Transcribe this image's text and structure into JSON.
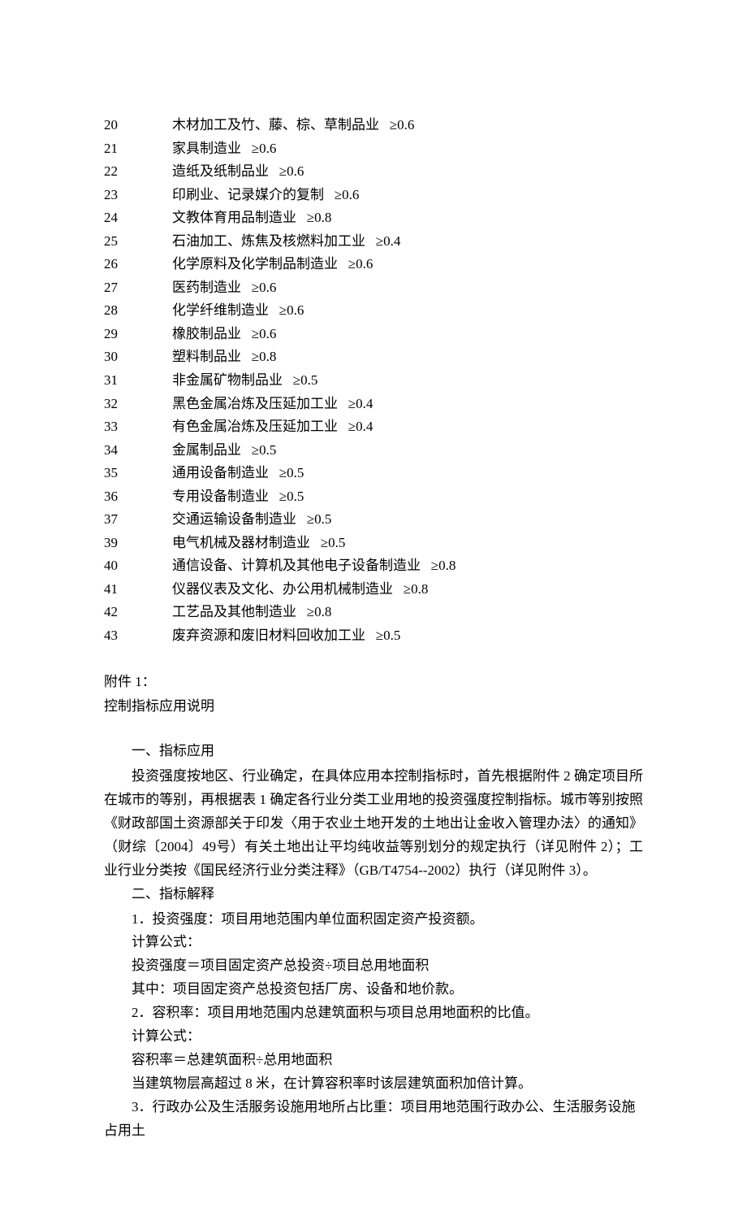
{
  "rows": [
    {
      "code": "20",
      "name": "木材加工及竹、藤、棕、草制品业",
      "value": "≥0.6"
    },
    {
      "code": "21",
      "name": "家具制造业",
      "value": "≥0.6"
    },
    {
      "code": "22",
      "name": "造纸及纸制品业",
      "value": "≥0.6"
    },
    {
      "code": "23",
      "name": "印刷业、记录媒介的复制",
      "value": "≥0.6"
    },
    {
      "code": "24",
      "name": "文教体育用品制造业",
      "value": "≥0.8"
    },
    {
      "code": "25",
      "name": "石油加工、炼焦及核燃料加工业",
      "value": "≥0.4"
    },
    {
      "code": "26",
      "name": "化学原料及化学制品制造业",
      "value": "≥0.6"
    },
    {
      "code": "27",
      "name": "医药制造业",
      "value": "≥0.6"
    },
    {
      "code": "28",
      "name": "化学纤维制造业",
      "value": "≥0.6"
    },
    {
      "code": "29",
      "name": "橡胶制品业",
      "value": "≥0.6"
    },
    {
      "code": "30",
      "name": "塑料制品业",
      "value": "≥0.8"
    },
    {
      "code": "31",
      "name": "非金属矿物制品业",
      "value": "≥0.5"
    },
    {
      "code": "32",
      "name": "黑色金属冶炼及压延加工业",
      "value": "≥0.4"
    },
    {
      "code": "33",
      "name": "有色金属冶炼及压延加工业",
      "value": "≥0.4"
    },
    {
      "code": "34",
      "name": "金属制品业",
      "value": "≥0.5"
    },
    {
      "code": "35",
      "name": "通用设备制造业",
      "value": "≥0.5"
    },
    {
      "code": "36",
      "name": "专用设备制造业",
      "value": "≥0.5"
    },
    {
      "code": "37",
      "name": "交通运输设备制造业",
      "value": "≥0.5"
    },
    {
      "code": "39",
      "name": "电气机械及器材制造业",
      "value": "≥0.5"
    },
    {
      "code": "40",
      "name": "通信设备、计算机及其他电子设备制造业",
      "value": "≥0.8"
    },
    {
      "code": "41",
      "name": "仪器仪表及文化、办公用机械制造业",
      "value": "≥0.8"
    },
    {
      "code": "42",
      "name": "工艺品及其他制造业",
      "value": "≥0.8"
    },
    {
      "code": "43",
      "name": "废弃资源和废旧材料回收加工业",
      "value": "≥0.5"
    }
  ],
  "attach": {
    "head": "附件 1：",
    "title": "控制指标应用说明"
  },
  "section1": {
    "title": "一、指标应用",
    "para": "投资强度按地区、行业确定，在具体应用本控制指标时，首先根据附件 2 确定项目所在城市的等别，再根据表 1 确定各行业分类工业用地的投资强度控制指标。城市等别按照《财政部国土资源部关于印发〈用于农业土地开发的土地出让金收入管理办法〉的通知》（财综〔2004〕49号）有关土地出让平均纯收益等别划分的规定执行（详见附件 2）；工业行业分类按《国民经济行业分类注释》（GB/T4754--2002）执行（详见附件 3）。"
  },
  "section2": {
    "title": "二、指标解释",
    "l1": "1．投资强度：项目用地范围内单位面积固定资产投资额。",
    "l2": "计算公式：",
    "l3": "投资强度＝项目固定资产总投资÷项目总用地面积",
    "l4": "其中：项目固定资产总投资包括厂房、设备和地价款。",
    "l5": "2．容积率：项目用地范围内总建筑面积与项目总用地面积的比值。",
    "l6": "计算公式：",
    "l7": "容积率＝总建筑面积÷总用地面积",
    "l8": "当建筑物层高超过 8 米，在计算容积率时该层建筑面积加倍计算。",
    "l9": "3．行政办公及生活服务设施用地所占比重：项目用地范围行政办公、生活服务设施占用土"
  }
}
